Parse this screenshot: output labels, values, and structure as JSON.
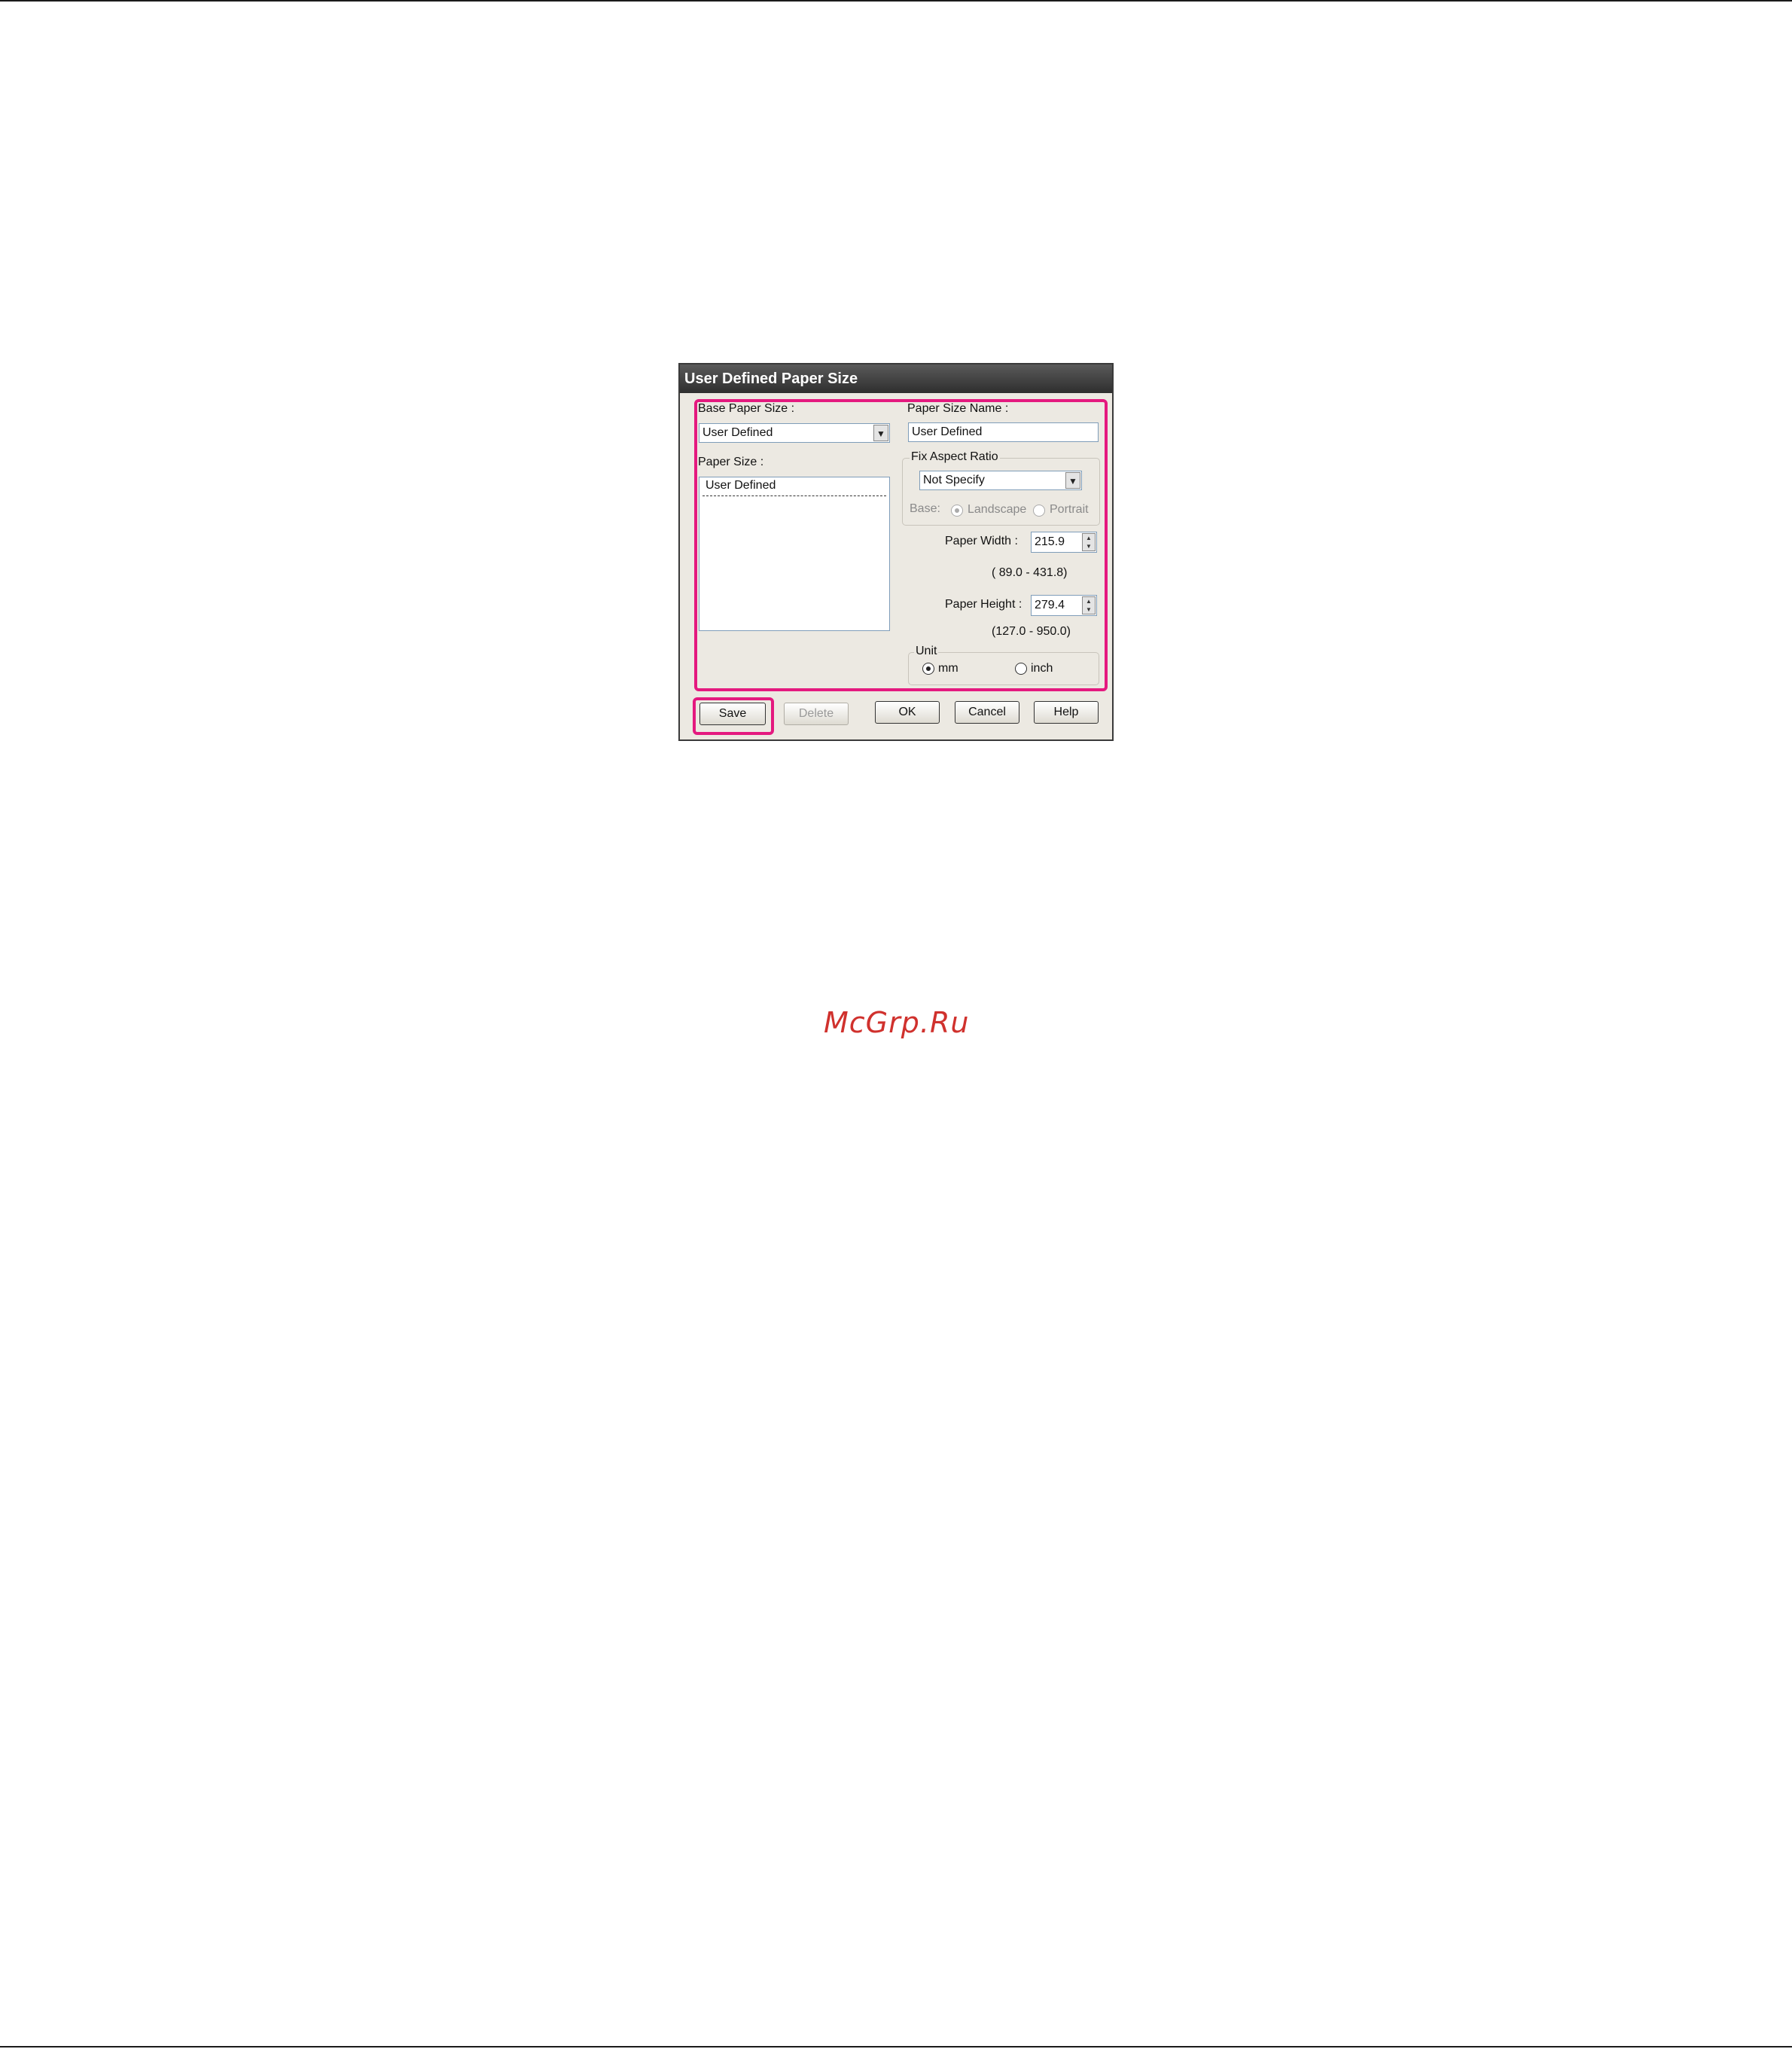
{
  "dialog": {
    "title": "User Defined Paper Size",
    "base_paper_size": {
      "label": "Base Paper Size :",
      "value": "User Defined"
    },
    "paper_size": {
      "label": "Paper Size :",
      "items": [
        "User Defined"
      ]
    },
    "paper_size_name": {
      "label": "Paper Size Name :",
      "value": "User Defined"
    },
    "fix_aspect_ratio": {
      "label": "Fix Aspect Ratio",
      "value": "Not Specify",
      "base_label": "Base:",
      "landscape": "Landscape",
      "portrait": "Portrait"
    },
    "paper_width": {
      "label": "Paper Width :",
      "value": "215.9",
      "range": "( 89.0 - 431.8)"
    },
    "paper_height": {
      "label": "Paper Height :",
      "value": "279.4",
      "range": "(127.0 - 950.0)"
    },
    "unit": {
      "label": "Unit",
      "mm": "mm",
      "inch": "inch",
      "selected": "mm"
    },
    "buttons": {
      "save": "Save",
      "delete": "Delete",
      "ok": "OK",
      "cancel": "Cancel",
      "help": "Help"
    },
    "highlight_color": "#e4197f"
  },
  "watermark": "McGrp.Ru"
}
